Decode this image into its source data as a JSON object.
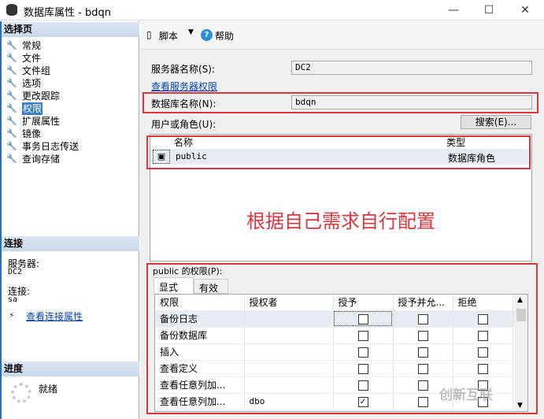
{
  "window": {
    "title": "数据库属性 - bdqn",
    "minimize": "—",
    "maximize": "☐",
    "close": "✕"
  },
  "left": {
    "select_page_header": "选择页",
    "pages": [
      {
        "label": "常规"
      },
      {
        "label": "文件"
      },
      {
        "label": "文件组"
      },
      {
        "label": "选项"
      },
      {
        "label": "更改跟踪"
      },
      {
        "label": "权限",
        "selected": true
      },
      {
        "label": "扩展属性"
      },
      {
        "label": "镜像"
      },
      {
        "label": "事务日志传送"
      },
      {
        "label": "查询存储"
      }
    ],
    "connection_header": "连接",
    "server_label": "服务器:",
    "server_value": "DC2",
    "connection_label": "连接:",
    "connection_value": "sa",
    "view_connection_link": "查看连接属性",
    "progress_header": "进度",
    "progress_status": "就绪"
  },
  "toolbar": {
    "script": "脚本",
    "help": "帮助"
  },
  "form": {
    "server_name_label": "服务器名称(S):",
    "server_name_value": "DC2",
    "view_server_perms_link": "查看服务器权限",
    "db_name_label": "数据库名称(N):",
    "db_name_value": "bdqn",
    "user_role_label": "用户或角色(U):",
    "search_button": "搜索(E)...",
    "users_columns": [
      "名称",
      "类型"
    ],
    "users": [
      {
        "name": "public",
        "type": "数据库角色"
      }
    ],
    "annotation": "根据自己需求自行配置",
    "perms_label": "public 的权限(P):",
    "tabs": [
      "显式",
      "有效"
    ],
    "perm_columns": [
      "权限",
      "授权者",
      "授予",
      "授予并允...",
      "拒绝"
    ],
    "permissions": [
      {
        "name": "备份日志",
        "grantor": "",
        "grant": false,
        "with_grant": false,
        "deny": false
      },
      {
        "name": "备份数据库",
        "grantor": "",
        "grant": false,
        "with_grant": false,
        "deny": false
      },
      {
        "name": "插入",
        "grantor": "",
        "grant": false,
        "with_grant": false,
        "deny": false
      },
      {
        "name": "查看定义",
        "grantor": "",
        "grant": false,
        "with_grant": false,
        "deny": false
      },
      {
        "name": "查看任意列加...",
        "grantor": "",
        "grant": false,
        "with_grant": false,
        "deny": false
      },
      {
        "name": "查看任意列加...",
        "grantor": "dbo",
        "grant": true,
        "with_grant": false,
        "deny": false
      }
    ]
  },
  "watermark": "创新互联",
  "colors": {
    "annotation_red": "#d9363e",
    "selection": "#3c7fc4"
  }
}
